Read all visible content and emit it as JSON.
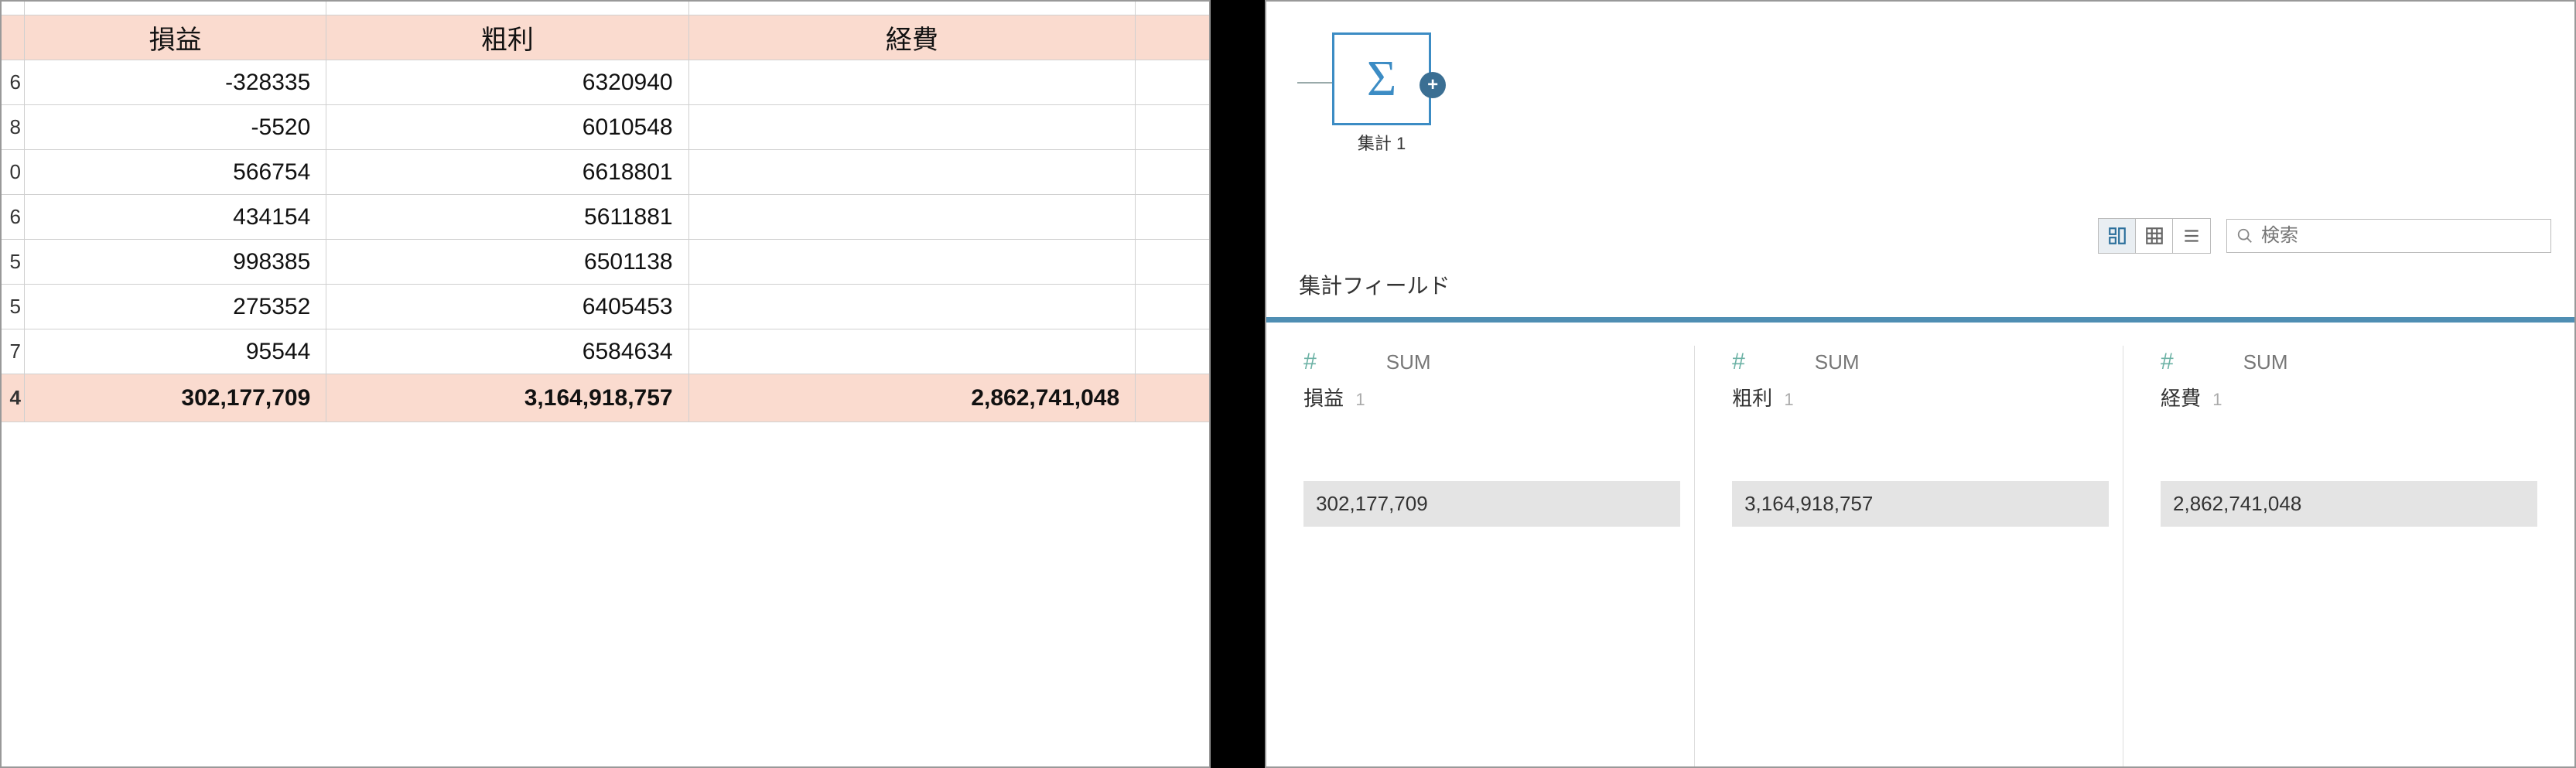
{
  "sheet": {
    "headers": {
      "c1": "損益",
      "c2": "粗利",
      "c3": "経費"
    },
    "row_fragments": [
      "6",
      "8",
      "0",
      "6",
      "5",
      "5",
      "7",
      "4"
    ],
    "rows": [
      {
        "c1": "-328335",
        "c2": "6320940",
        "c3": ""
      },
      {
        "c1": "-5520",
        "c2": "6010548",
        "c3": ""
      },
      {
        "c1": "566754",
        "c2": "6618801",
        "c3": ""
      },
      {
        "c1": "434154",
        "c2": "5611881",
        "c3": ""
      },
      {
        "c1": "998385",
        "c2": "6501138",
        "c3": ""
      },
      {
        "c1": "275352",
        "c2": "6405453",
        "c3": ""
      },
      {
        "c1": "95544",
        "c2": "6584634",
        "c3": ""
      }
    ],
    "totals": {
      "c1": "302,177,709",
      "c2": "3,164,918,757",
      "c3": "2,862,741,048"
    }
  },
  "flow": {
    "node_label": "集計 1",
    "sigma": "Σ",
    "plus": "+"
  },
  "toolbar": {
    "search_placeholder": "検索"
  },
  "section": {
    "title": "集計フィールド"
  },
  "cards": [
    {
      "type": "#",
      "agg": "SUM",
      "field": "損益",
      "idx": "1",
      "value": "302,177,709"
    },
    {
      "type": "#",
      "agg": "SUM",
      "field": "粗利",
      "idx": "1",
      "value": "3,164,918,757"
    },
    {
      "type": "#",
      "agg": "SUM",
      "field": "経費",
      "idx": "1",
      "value": "2,862,741,048"
    }
  ]
}
